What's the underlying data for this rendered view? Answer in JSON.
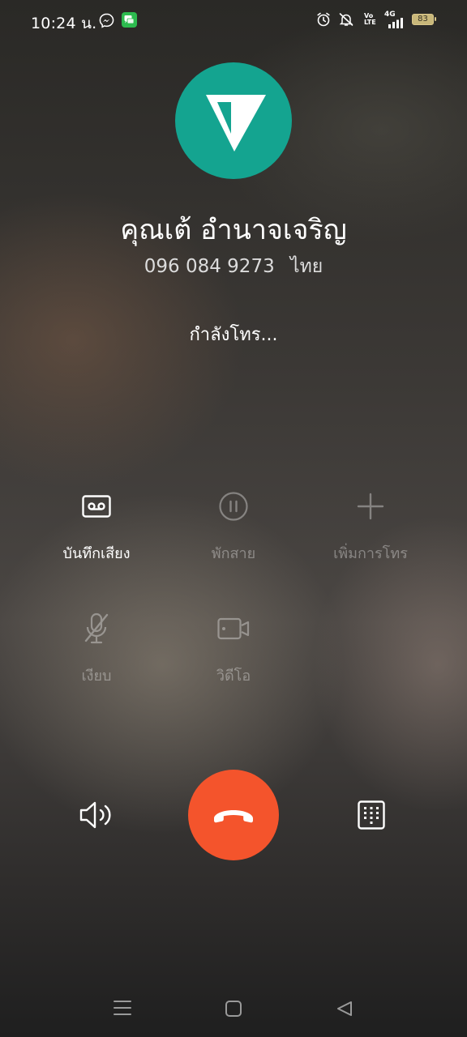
{
  "status_bar": {
    "time": "10:24 น.",
    "battery_level": "83",
    "network_label": "4G",
    "volte_label": "Vo LTE",
    "icons": [
      "messenger-icon",
      "messages-icon",
      "alarm-icon",
      "silent-bell-icon",
      "volte-icon",
      "signal-icon",
      "battery-icon"
    ]
  },
  "contact": {
    "name": "คุณเต้ อำนาจเจริญ",
    "number": "096 084 9273",
    "country": "ไทย",
    "avatar_color": "#14a490"
  },
  "call": {
    "status": "กำลังโทร..."
  },
  "actions": {
    "record": {
      "label": "บันทึกเสียง",
      "icon": "record-icon"
    },
    "hold": {
      "label": "พักสาย",
      "icon": "pause-icon"
    },
    "add_call": {
      "label": "เพิ่มการโทร",
      "icon": "plus-icon"
    },
    "mute": {
      "label": "เงียบ",
      "icon": "mute-mic-icon"
    },
    "video": {
      "label": "วิดีโอ",
      "icon": "video-icon"
    }
  },
  "controls": {
    "speaker_icon": "speaker-icon",
    "end_call_icon": "end-call-icon",
    "keypad_icon": "keypad-icon",
    "end_call_color": "#f4542c"
  },
  "nav": {
    "icons": [
      "menu-icon",
      "home-icon",
      "back-icon"
    ]
  }
}
